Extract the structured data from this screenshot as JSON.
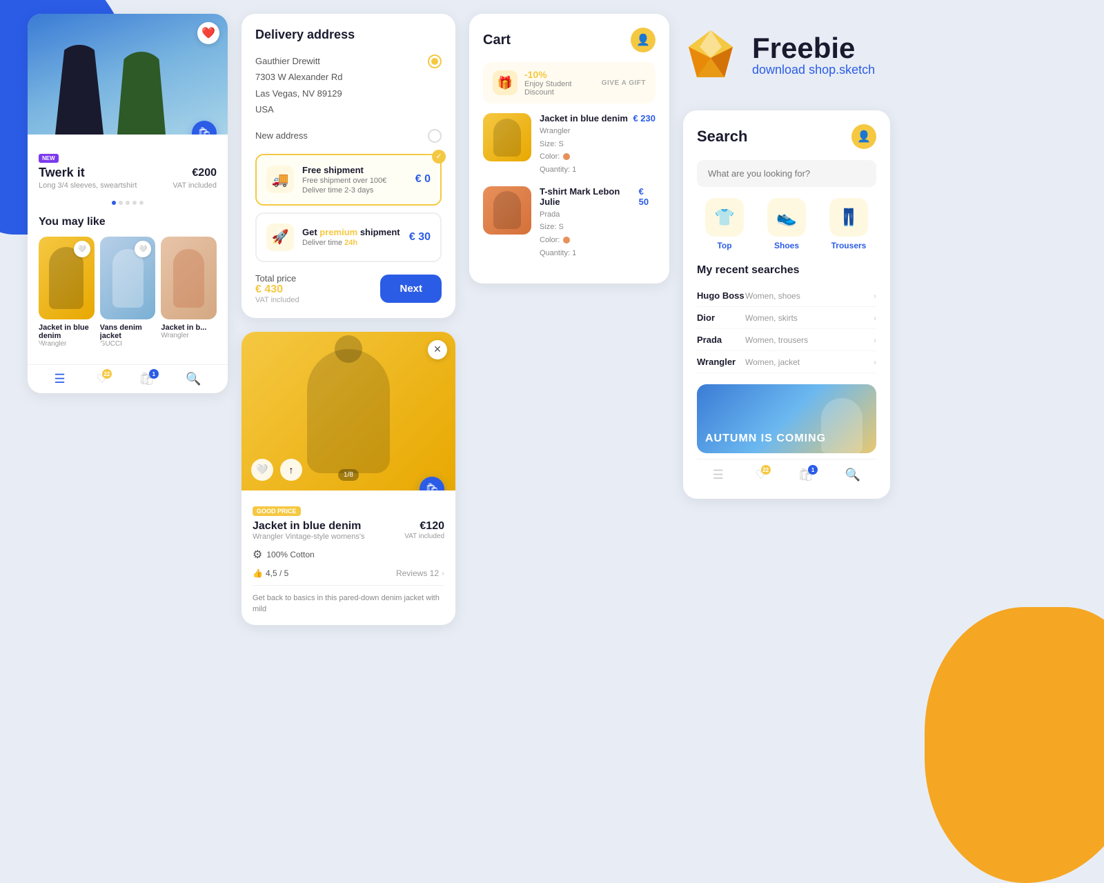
{
  "background": {
    "blob_blue": "#2b5ce6",
    "blob_yellow": "#f5a623"
  },
  "freebie": {
    "title": "Freebie",
    "subtitle": "download shop.sketch"
  },
  "product_card": {
    "badge": "NEW",
    "title": "Twerk it",
    "price": "€200",
    "description": "Long 3/4 sleeves, sweartshirt",
    "vat": "VAT included",
    "section_title": "You may like",
    "items": [
      {
        "name": "Jacket in blue denim",
        "brand": "Wrangler"
      },
      {
        "name": "Vans denim jacket",
        "brand": "GUCCI"
      },
      {
        "name": "Jacket in b...",
        "brand": "Wrangler"
      }
    ]
  },
  "delivery": {
    "title": "Delivery address",
    "name": "Gauthier Drewitt",
    "street": "7303 W Alexander Rd",
    "city": "Las Vegas, NV 89129",
    "country": "USA",
    "new_address_label": "New address",
    "free_shipment": {
      "name": "Free shipment",
      "desc1": "Free shipment over 100€",
      "desc2": "Deliver time 2-3 days",
      "price": "€ 0"
    },
    "premium_shipment": {
      "prefix": "Get ",
      "highlight": "premium",
      "suffix": " shipment",
      "desc": "Deliver time ",
      "time": "24h",
      "price": "€ 30"
    },
    "total_label": "Total price",
    "total_price": "€ 430",
    "vat_note": "VAT included",
    "next_btn": "Next"
  },
  "product_detail": {
    "badge": "GOOD PRICE",
    "title": "Jacket in blue denim",
    "price": "€120",
    "brand": "Wrangler Vintage-style womens's",
    "vat": "VAT included",
    "material": "100% Cotton",
    "rating": "4,5 / 5",
    "reviews_label": "Reviews 12",
    "image_counter": "1/8",
    "description": "Get back to basics in this pared-down denim jacket with mild"
  },
  "cart": {
    "title": "Cart",
    "discount_pct": "-10%",
    "discount_desc": "Enjoy Student Discount",
    "give_gift_btn": "GIVE A GIFT",
    "items": [
      {
        "name": "Jacket in blue denim",
        "price": "€ 230",
        "brand": "Wrangler",
        "size": "S",
        "color_label": "Color:",
        "qty": "Quantity: 1"
      },
      {
        "name": "T-shirt Mark Lebon Julie",
        "price": "€ 50",
        "brand": "Prada",
        "size": "S",
        "color_label": "Color:",
        "qty": "Quantity: 1"
      }
    ]
  },
  "search": {
    "title": "Search",
    "placeholder": "What are you looking for?",
    "categories": [
      {
        "label": "Top",
        "icon": "👕"
      },
      {
        "label": "Shoes",
        "icon": "👟"
      },
      {
        "label": "Trousers",
        "icon": "👖"
      }
    ],
    "recent_title": "My recent searches",
    "recent_items": [
      {
        "brand": "Hugo Boss",
        "desc": "Women, shoes"
      },
      {
        "brand": "Dior",
        "desc": "Women, skirts"
      },
      {
        "brand": "Prada",
        "desc": "Women, trousers"
      },
      {
        "brand": "Wrangler",
        "desc": "Women, jacket"
      }
    ],
    "promo_text": "AUTUMN IS COMING"
  },
  "nav": {
    "cart_badge": "1",
    "heart_badge": "22"
  }
}
